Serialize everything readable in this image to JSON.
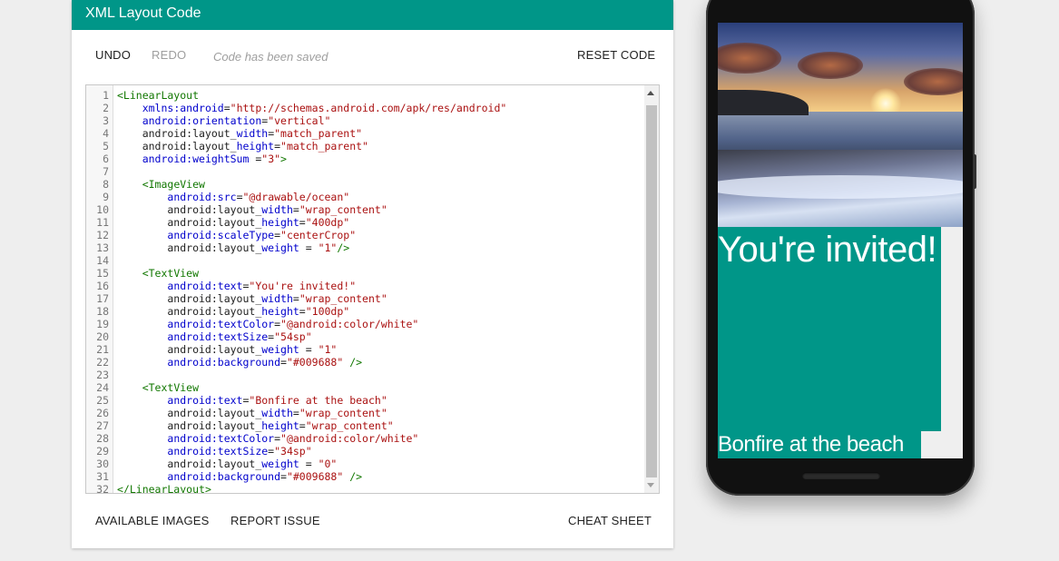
{
  "card": {
    "title": "XML Layout Code",
    "undo": "UNDO",
    "redo": "REDO",
    "status": "Code has been saved",
    "reset": "RESET CODE",
    "available_images": "AVAILABLE IMAGES",
    "report_issue": "REPORT ISSUE",
    "cheat_sheet": "CHEAT SHEET"
  },
  "code": [
    "<LinearLayout",
    "    xmlns:android=\"http://schemas.android.com/apk/res/android\"",
    "    android:orientation=\"vertical\"",
    "    android:layout_width=\"match_parent\"",
    "    android:layout_height=\"match_parent\"",
    "    android:weightSum =\"3\">",
    "",
    "    <ImageView",
    "        android:src=\"@drawable/ocean\"",
    "        android:layout_width=\"wrap_content\"",
    "        android:layout_height=\"400dp\"",
    "        android:scaleType=\"centerCrop\"",
    "        android:layout_weight = \"1\"/>",
    "",
    "    <TextView",
    "        android:text=\"You're invited!\"",
    "        android:layout_width=\"wrap_content\"",
    "        android:layout_height=\"100dp\"",
    "        android:textColor=\"@android:color/white\"",
    "        android:textSize=\"54sp\"",
    "        android:layout_weight = \"1\"",
    "        android:background=\"#009688\" />",
    "",
    "    <TextView",
    "        android:text=\"Bonfire at the beach\"",
    "        android:layout_width=\"wrap_content\"",
    "        android:layout_height=\"wrap_content\"",
    "        android:textColor=\"@android:color/white\"",
    "        android:textSize=\"34sp\"",
    "        android:layout_weight = \"0\"",
    "        android:background=\"#009688\" />",
    "</LinearLayout>"
  ],
  "preview": {
    "image": "ocean-image",
    "invited_text": "You're invited!",
    "bonfire_text": "Bonfire at the beach",
    "accent": "#009688"
  },
  "colors": {
    "header": "#009688",
    "tag": "#117700",
    "attr": "#0000cc",
    "value": "#aa1111"
  }
}
